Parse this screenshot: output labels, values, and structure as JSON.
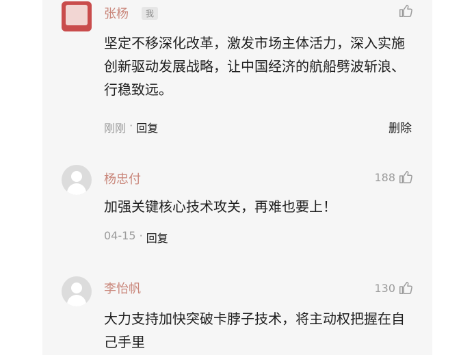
{
  "comments": [
    {
      "name": "张杨",
      "badge": "我",
      "content": "坚定不移深化改革，激发市场主体活力，深入实施创新驱动发展战略，让中国经济的航船劈波斩浪、行稳致远。",
      "time": "刚刚",
      "separator": " · ",
      "reply": "回复",
      "delete": "删除",
      "likes": ""
    },
    {
      "name": "杨忠付",
      "content": "加强关键核心技术攻关，再难也要上！",
      "time": "04-15",
      "separator": " · ",
      "reply": "回复",
      "likes": "188"
    },
    {
      "name": "李怡帆",
      "content": "大力支持加快突破卡脖子技术，将主动权把握在自己手里",
      "likes": "130"
    }
  ]
}
